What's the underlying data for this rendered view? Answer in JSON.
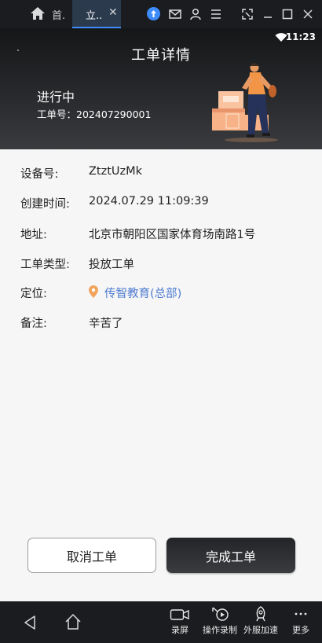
{
  "emulator": {
    "tab_home_label": "首.",
    "tab_active_label": "立..",
    "tab_close": "✕"
  },
  "status_bar": {
    "time": "11:23"
  },
  "header": {
    "title": "工单详情",
    "status": "进行中",
    "order_number_label": "工单号：",
    "order_number": "202407290001"
  },
  "details": [
    {
      "label": "设备号:",
      "value": "ZtztUzMk"
    },
    {
      "label": "创建时间:",
      "value": "2024.07.29 11:09:39"
    },
    {
      "label": "地址:",
      "value": "北京市朝阳区国家体育场南路1号"
    },
    {
      "label": "工单类型:",
      "value": "投放工单"
    },
    {
      "label": "定位:",
      "value": "传智教育(总部)"
    },
    {
      "label": "备注:",
      "value": "辛苦了"
    }
  ],
  "actions": {
    "cancel": "取消工单",
    "complete": "完成工单"
  },
  "bottom_tools": [
    {
      "label": "录屏",
      "icon": "screen-record-icon"
    },
    {
      "label": "操作录制",
      "icon": "operation-record-icon"
    },
    {
      "label": "外服加速",
      "icon": "rocket-icon"
    },
    {
      "label": "更多",
      "icon": "more-icon"
    }
  ],
  "colors": {
    "accent_link": "#4d7bd1",
    "pin": "#f2a35c",
    "emulator_bg": "#1b1c1f"
  }
}
